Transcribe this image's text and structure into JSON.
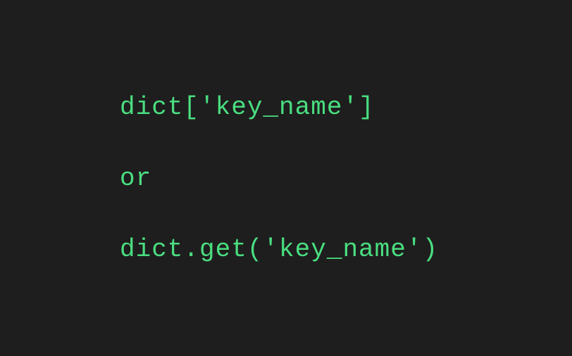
{
  "code": {
    "line1": "dict['key_name']",
    "line2": "or",
    "line3": "dict.get('key_name')"
  }
}
